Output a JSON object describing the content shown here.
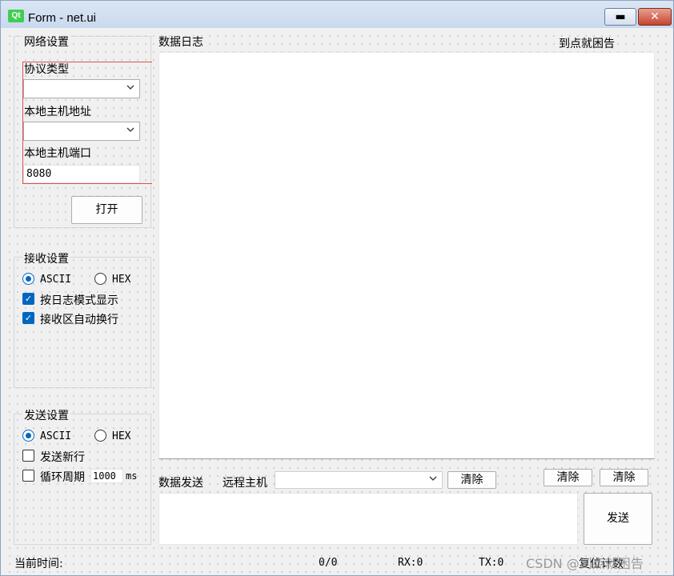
{
  "window": {
    "icon_text": "Qt",
    "title": "Form - net.ui",
    "min_symbol": "▬",
    "close_symbol": "✕"
  },
  "network": {
    "title": "网络设置",
    "protocol_label": "协议类型",
    "protocol_value": "",
    "local_host_label": "本地主机地址",
    "local_host_value": "",
    "local_port_label": "本地主机端口",
    "local_port_value": "8080",
    "open_button": "打开"
  },
  "receive": {
    "title": "接收设置",
    "ascii_label": "ASCII",
    "hex_label": "HEX",
    "ascii_selected": true,
    "log_mode_label": "按日志模式显示",
    "log_mode_checked": true,
    "auto_wrap_label": "接收区自动换行",
    "auto_wrap_checked": true
  },
  "send": {
    "title": "发送设置",
    "ascii_label": "ASCII",
    "hex_label": "HEX",
    "ascii_selected": true,
    "newline_label": "发送新行",
    "newline_checked": false,
    "cycle_label": "循环周期",
    "cycle_checked": false,
    "cycle_value": "1000",
    "cycle_unit": "ms"
  },
  "log": {
    "title": "数据日志",
    "top_right_label": "到点就困告"
  },
  "data_send": {
    "title": "数据发送",
    "remote_host_label": "远程主机",
    "remote_host_value": "",
    "clear_remote_button": "清除",
    "clear_button_1": "清除",
    "clear_button_2": "清除",
    "send_button": "发送"
  },
  "status": {
    "time_label": "当前时间:",
    "counter": "0/0",
    "rx": "RX:0",
    "tx": "TX:0",
    "reset_label": "复位计数"
  },
  "watermark": "CSDN @到点就困告",
  "icons": {
    "chevron": "chevron-down-icon",
    "check": "checkmark-icon"
  },
  "colors": {
    "accent": "#0067c0",
    "qt_green": "#41cd52",
    "close_red": "#c4452e"
  }
}
